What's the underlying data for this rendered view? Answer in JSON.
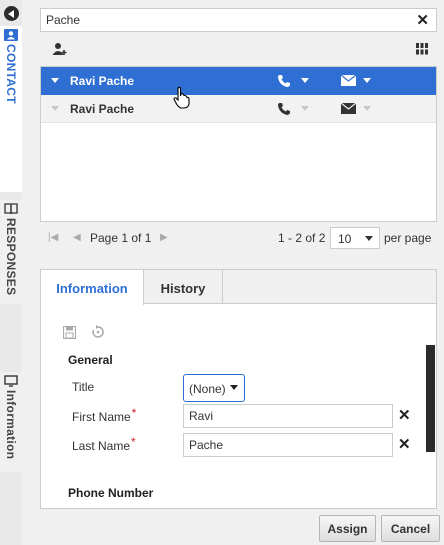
{
  "sidebar": {
    "tabs": [
      {
        "label": "CONTACT",
        "icon": "contact-card-icon",
        "active": true
      },
      {
        "label": "RESPONSES",
        "icon": "book-icon"
      },
      {
        "label": "Information",
        "icon": "monitor-icon"
      }
    ]
  },
  "search": {
    "value": "Pache"
  },
  "results": {
    "rows": [
      {
        "name": "Ravi Pache",
        "selected": true
      },
      {
        "name": "Ravi Pache",
        "selected": false
      }
    ]
  },
  "pagination": {
    "page_text": "Page 1 of 1",
    "range_text": "1 - 2 of 2",
    "page_size": "10",
    "per_page_label": "per page"
  },
  "detail": {
    "tabs": [
      "Information",
      "History"
    ],
    "active_tab": "Information",
    "general_heading": "General",
    "title_label": "Title",
    "title_value": "(None)",
    "first_name_label": "First Name",
    "first_name_value": "Ravi",
    "last_name_label": "Last Name",
    "last_name_value": "Pache",
    "required_mark": "*",
    "phone_heading": "Phone Number"
  },
  "actions": {
    "assign": "Assign",
    "cancel": "Cancel"
  },
  "colors": {
    "accent": "#2f6fd4",
    "required": "#d0202e"
  }
}
